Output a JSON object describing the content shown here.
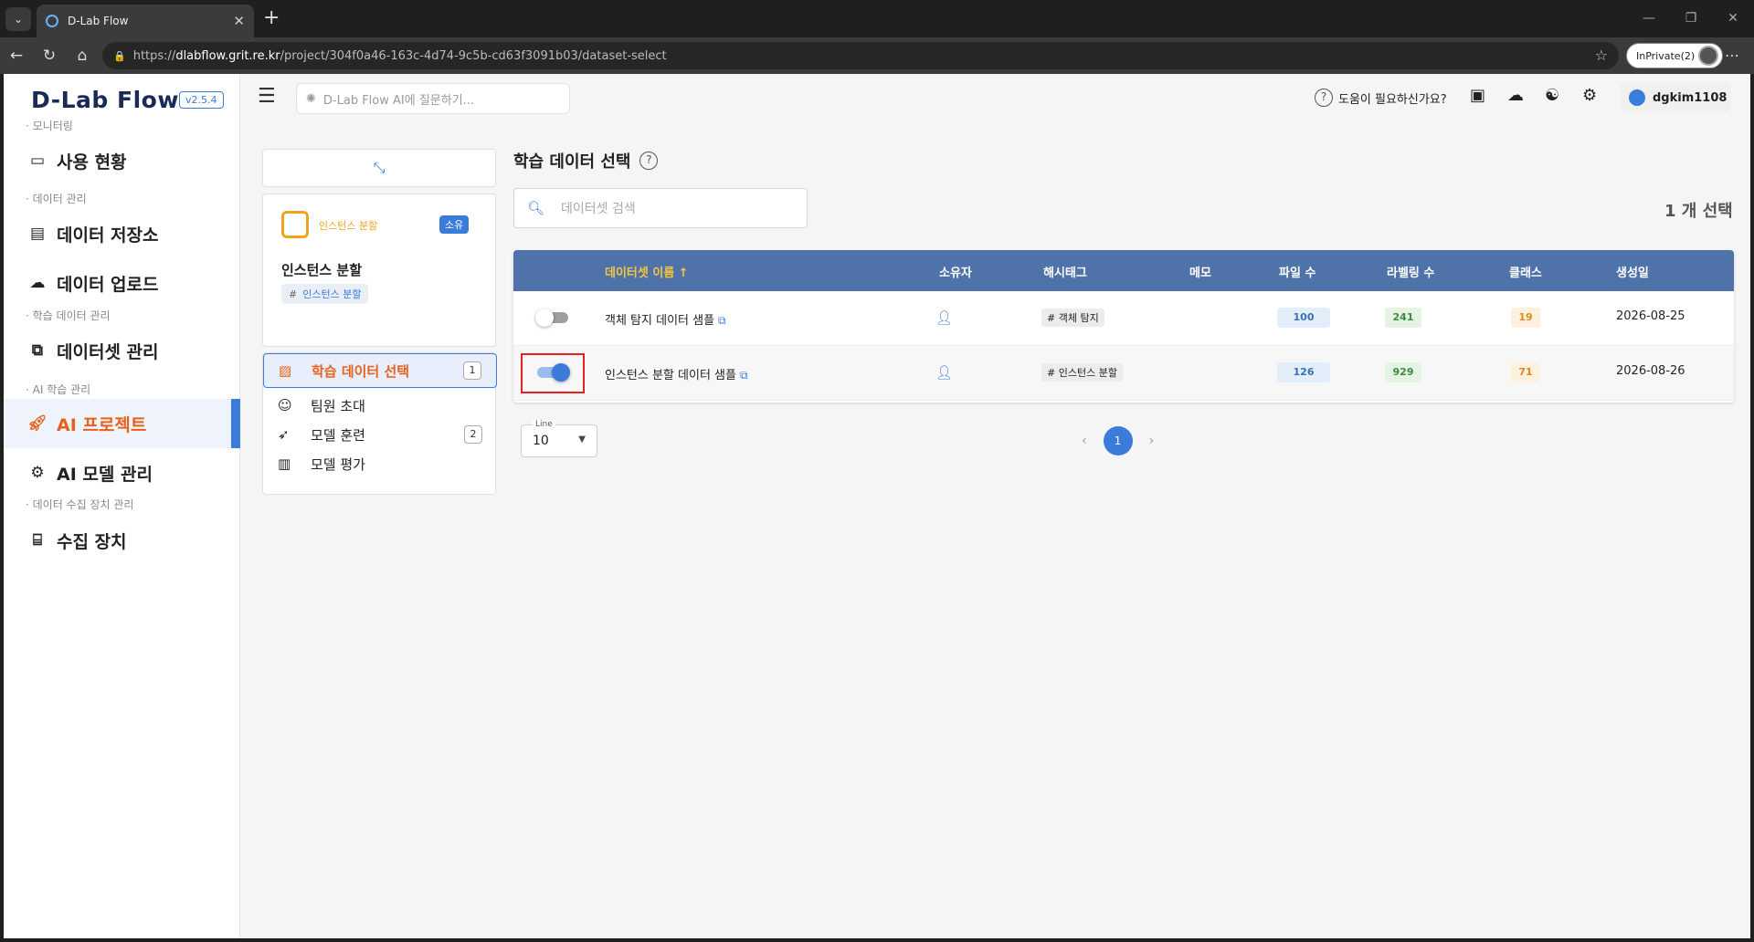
{
  "browser": {
    "tab_title": "D-Lab Flow",
    "url_prefix": "https://",
    "url_host": "dlabflow.grit.re.kr",
    "url_path": "/project/304f0a46-163c-4d74-9c5b-cd63f3091b03/dataset-select",
    "profile": "InPrivate(2)"
  },
  "sidebar": {
    "logo": "D-Lab Flow",
    "version": "v2.5.4",
    "sections": [
      {
        "label": "· 모니터링",
        "items": [
          {
            "label": "사용 현황",
            "icon": "monitor-icon"
          }
        ]
      },
      {
        "label": "· 데이터 관리",
        "items": [
          {
            "label": "데이터 저장소",
            "icon": "storage-icon"
          },
          {
            "label": "데이터 업로드",
            "icon": "cloud-upload-icon"
          }
        ]
      },
      {
        "label": "· 학습 데이터 관리",
        "items": [
          {
            "label": "데이터셋 관리",
            "icon": "dataset-icon"
          }
        ]
      },
      {
        "label": "· AI 학습 관리",
        "items": [
          {
            "label": "AI 프로젝트",
            "icon": "rocket-icon",
            "active": true
          },
          {
            "label": "AI 모델 관리",
            "icon": "model-icon"
          }
        ]
      },
      {
        "label": "· 데이터 수집 장치 관리",
        "items": [
          {
            "label": "수집 장치",
            "icon": "device-icon"
          }
        ]
      }
    ]
  },
  "topbar": {
    "ai_search_placeholder": "D-Lab Flow AI에 질문하기...",
    "help": "도움이 필요하신가요?",
    "username": "dgkim1108"
  },
  "project": {
    "type": "인스턴스 분할",
    "badge": "소유",
    "name": "인스턴스 분할",
    "tag": "인스턴스 분할"
  },
  "project_menu": [
    {
      "label": "학습 데이터 선택",
      "count": "1",
      "active": true,
      "icon": "image-icon"
    },
    {
      "label": "팀원 초대",
      "count": "",
      "icon": "user-add-icon"
    },
    {
      "label": "모델 훈련",
      "count": "2",
      "icon": "rocket-icon"
    },
    {
      "label": "모델 평가",
      "count": "",
      "icon": "bar-chart-icon"
    }
  ],
  "main": {
    "title": "학습 데이터 선택",
    "search_placeholder": "데이터셋 검색",
    "selected_count": "1 개 선택",
    "columns": [
      "데이터셋 이름 ↑",
      "소유자",
      "해시태그",
      "메모",
      "파일 수",
      "라벨링 수",
      "클래스",
      "생성일"
    ],
    "rows": [
      {
        "selected": false,
        "name": "객체 탐지 데이터 샘플",
        "hashtag": "객체 탐지",
        "memo": "",
        "files": "100",
        "labels": "241",
        "classes": "19",
        "created": "2026-08-25"
      },
      {
        "selected": true,
        "name": "인스턴스 분할 데이터 샘플",
        "hashtag": "인스턴스 분할",
        "memo": "",
        "files": "126",
        "labels": "929",
        "classes": "71",
        "created": "2026-08-26"
      }
    ],
    "line_label": "Line",
    "line_value": "10",
    "current_page": "1"
  }
}
